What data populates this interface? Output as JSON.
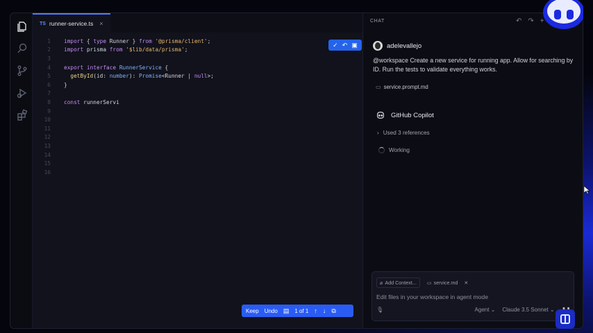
{
  "editor": {
    "tab": {
      "lang_badge": "TS",
      "filename": "runner-service.ts",
      "close": "×"
    },
    "lines": [
      {
        "n": "1",
        "tokens": [
          [
            "kw",
            "import"
          ],
          [
            "pl",
            " { "
          ],
          [
            "kw",
            "type"
          ],
          [
            "pl",
            " Runner } "
          ],
          [
            "kw",
            "from"
          ],
          [
            "pl",
            " "
          ],
          [
            "st",
            "'@prisma/client'"
          ],
          [
            "pl",
            ";"
          ]
        ]
      },
      {
        "n": "2",
        "tokens": [
          [
            "kw",
            "import"
          ],
          [
            "pl",
            " prisma "
          ],
          [
            "kw",
            "from"
          ],
          [
            "pl",
            " "
          ],
          [
            "st",
            "'$lib/data/prisma'"
          ],
          [
            "pl",
            ";"
          ]
        ]
      },
      {
        "n": "3",
        "tokens": []
      },
      {
        "n": "4",
        "tokens": [
          [
            "kw",
            "export"
          ],
          [
            "pl",
            " "
          ],
          [
            "kw",
            "interface"
          ],
          [
            "pl",
            " "
          ],
          [
            "nm",
            "RunnerService"
          ],
          [
            "pl",
            " {"
          ]
        ]
      },
      {
        "n": "5",
        "tokens": [
          [
            "pl",
            "  "
          ],
          [
            "fn",
            "getById"
          ],
          [
            "pl",
            "(id: "
          ],
          [
            "nm",
            "number"
          ],
          [
            "pl",
            "): "
          ],
          [
            "nm",
            "Promise"
          ],
          [
            "pl",
            "<Runner | "
          ],
          [
            "kw",
            "null"
          ],
          [
            "pl",
            ">;"
          ]
        ]
      },
      {
        "n": "6",
        "tokens": [
          [
            "pl",
            "}"
          ]
        ]
      },
      {
        "n": "7",
        "tokens": []
      },
      {
        "n": "8",
        "tokens": [
          [
            "kw",
            "const"
          ],
          [
            "pl",
            " runnerServi"
          ]
        ]
      },
      {
        "n": "9",
        "tokens": []
      },
      {
        "n": "10",
        "tokens": []
      },
      {
        "n": "11",
        "tokens": []
      },
      {
        "n": "12",
        "tokens": []
      },
      {
        "n": "13",
        "tokens": []
      },
      {
        "n": "14",
        "tokens": []
      },
      {
        "n": "15",
        "tokens": []
      },
      {
        "n": "16",
        "tokens": []
      }
    ],
    "keep_bar": {
      "keep": "Keep",
      "undo": "Undo",
      "counter": "1 of 1"
    }
  },
  "chat": {
    "header": "CHAT",
    "user": {
      "name": "adelevallejo"
    },
    "prompt": "@workspace Create a new service for running app. Allow for searching by ID. Run the tests to validate everything works.",
    "attachment": "service.prompt.md",
    "assistant": {
      "name": "GitHub Copilot"
    },
    "references": {
      "chevron": "›",
      "label": "Used 3 references"
    },
    "status": "Working",
    "input": {
      "add_context": "Add Context...",
      "file_chip": "service.md",
      "placeholder": "Edit files in your workspace in agent mode",
      "mode": "Agent",
      "model": "Claude 3.5 Sonnet"
    }
  },
  "colors": {
    "accent": "#2563eb",
    "background": "#0c0d14",
    "glow": "#1b2bd6"
  }
}
